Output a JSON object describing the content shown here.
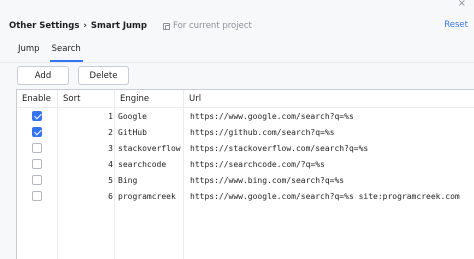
{
  "header": {
    "breadcrumb_parent": "Other Settings",
    "breadcrumb_sep": "›",
    "breadcrumb_current": "Smart Jump",
    "scope_label": "For current project",
    "reset_label": "Reset",
    "close_glyph": "×"
  },
  "tabs": [
    {
      "label": "Jump",
      "active": false
    },
    {
      "label": "Search",
      "active": true
    }
  ],
  "toolbar": {
    "add_label": "Add",
    "delete_label": "Delete"
  },
  "table": {
    "columns": [
      "Enable",
      "Sort",
      "Engine",
      "Url"
    ],
    "rows": [
      {
        "enabled": true,
        "sort": "1",
        "engine": "Google",
        "url": "https://www.google.com/search?q=%s"
      },
      {
        "enabled": true,
        "sort": "2",
        "engine": "GitHub",
        "url": "https://github.com/search?q=%s"
      },
      {
        "enabled": false,
        "sort": "3",
        "engine": "stackoverflow",
        "url": "https://stackoverflow.com/search?q=%s"
      },
      {
        "enabled": false,
        "sort": "4",
        "engine": "searchcode",
        "url": "https://searchcode.com/?q=%s"
      },
      {
        "enabled": false,
        "sort": "5",
        "engine": "Bing",
        "url": "https://www.bing.com/search?q=%s"
      },
      {
        "enabled": false,
        "sort": "6",
        "engine": "programcreek",
        "url": "https://www.google.com/search?q=%s site:programcreek.com"
      }
    ]
  },
  "colors": {
    "accent": "#3574f0",
    "muted": "#8c8f96"
  }
}
